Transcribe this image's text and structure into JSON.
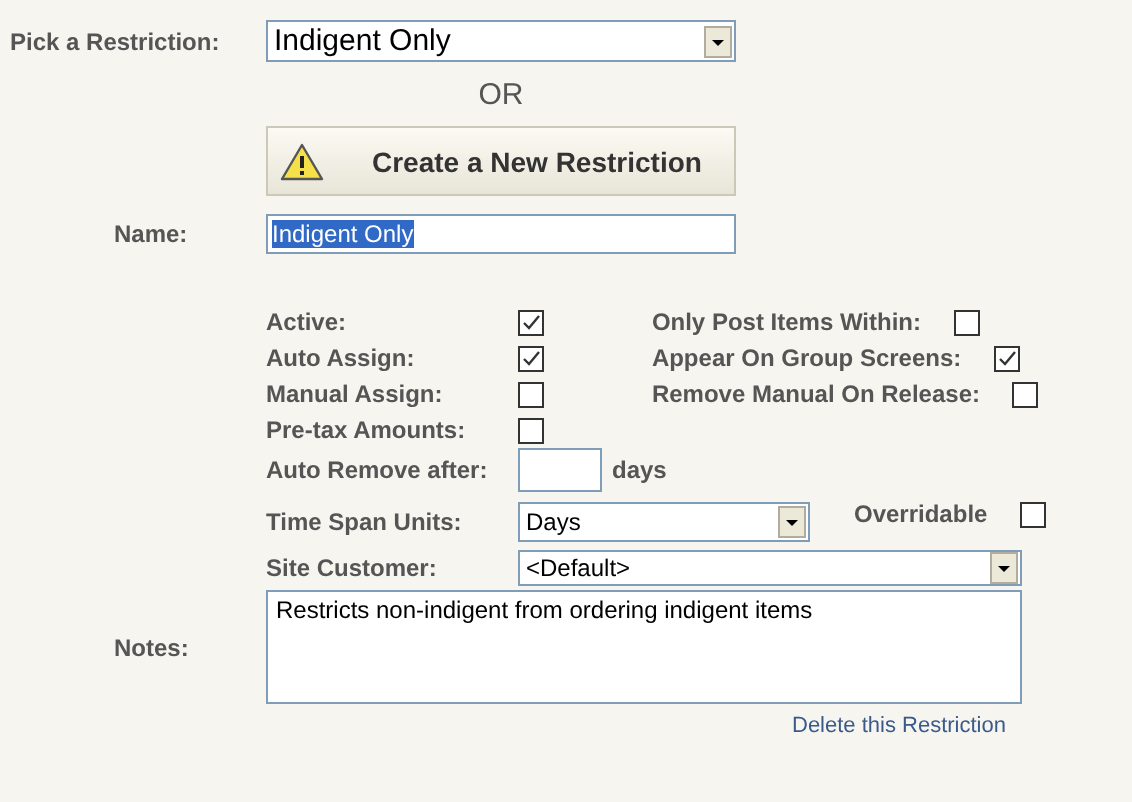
{
  "pick": {
    "label": "Pick a Restriction:",
    "value": "Indigent Only"
  },
  "or_text": "OR",
  "create_button": {
    "label": "Create a New Restriction"
  },
  "name": {
    "label": "Name:",
    "value": "Indigent Only"
  },
  "left_flags": [
    {
      "label": "Active:",
      "checked": true
    },
    {
      "label": "Auto Assign:",
      "checked": true
    },
    {
      "label": "Manual Assign:",
      "checked": false
    },
    {
      "label": "Pre-tax Amounts:",
      "checked": false
    }
  ],
  "right_flags": [
    {
      "label": "Only Post Items Within:",
      "checked": false
    },
    {
      "label": "Appear On Group Screens:",
      "checked": true
    },
    {
      "label": "Remove Manual On Release:",
      "checked": false
    }
  ],
  "auto_remove": {
    "label": "Auto Remove after:",
    "unit": "days"
  },
  "time_span": {
    "label": "Time Span Units:",
    "value": "Days"
  },
  "overridable": {
    "label": "Overridable",
    "checked": false
  },
  "site_customer": {
    "label": "Site Customer:",
    "value": "<Default>"
  },
  "notes": {
    "label": "Notes:",
    "value": "Restricts non-indigent from ordering indigent items"
  },
  "delete_link": "Delete this Restriction"
}
